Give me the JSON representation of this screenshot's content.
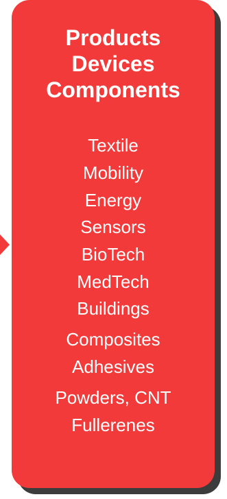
{
  "card": {
    "headings": [
      "Products",
      "Devices",
      "Components"
    ],
    "items": [
      "Textile",
      "Mobility",
      "Energy",
      "Sensors",
      "BioTech",
      "MedTech",
      "Buildings",
      "Composites",
      "Adhesives",
      "Powders, CNT",
      "Fullerenes"
    ]
  },
  "colors": {
    "card_fill": "#f23a3a",
    "shadow": "#3c3c3c",
    "text": "#ffffff"
  }
}
